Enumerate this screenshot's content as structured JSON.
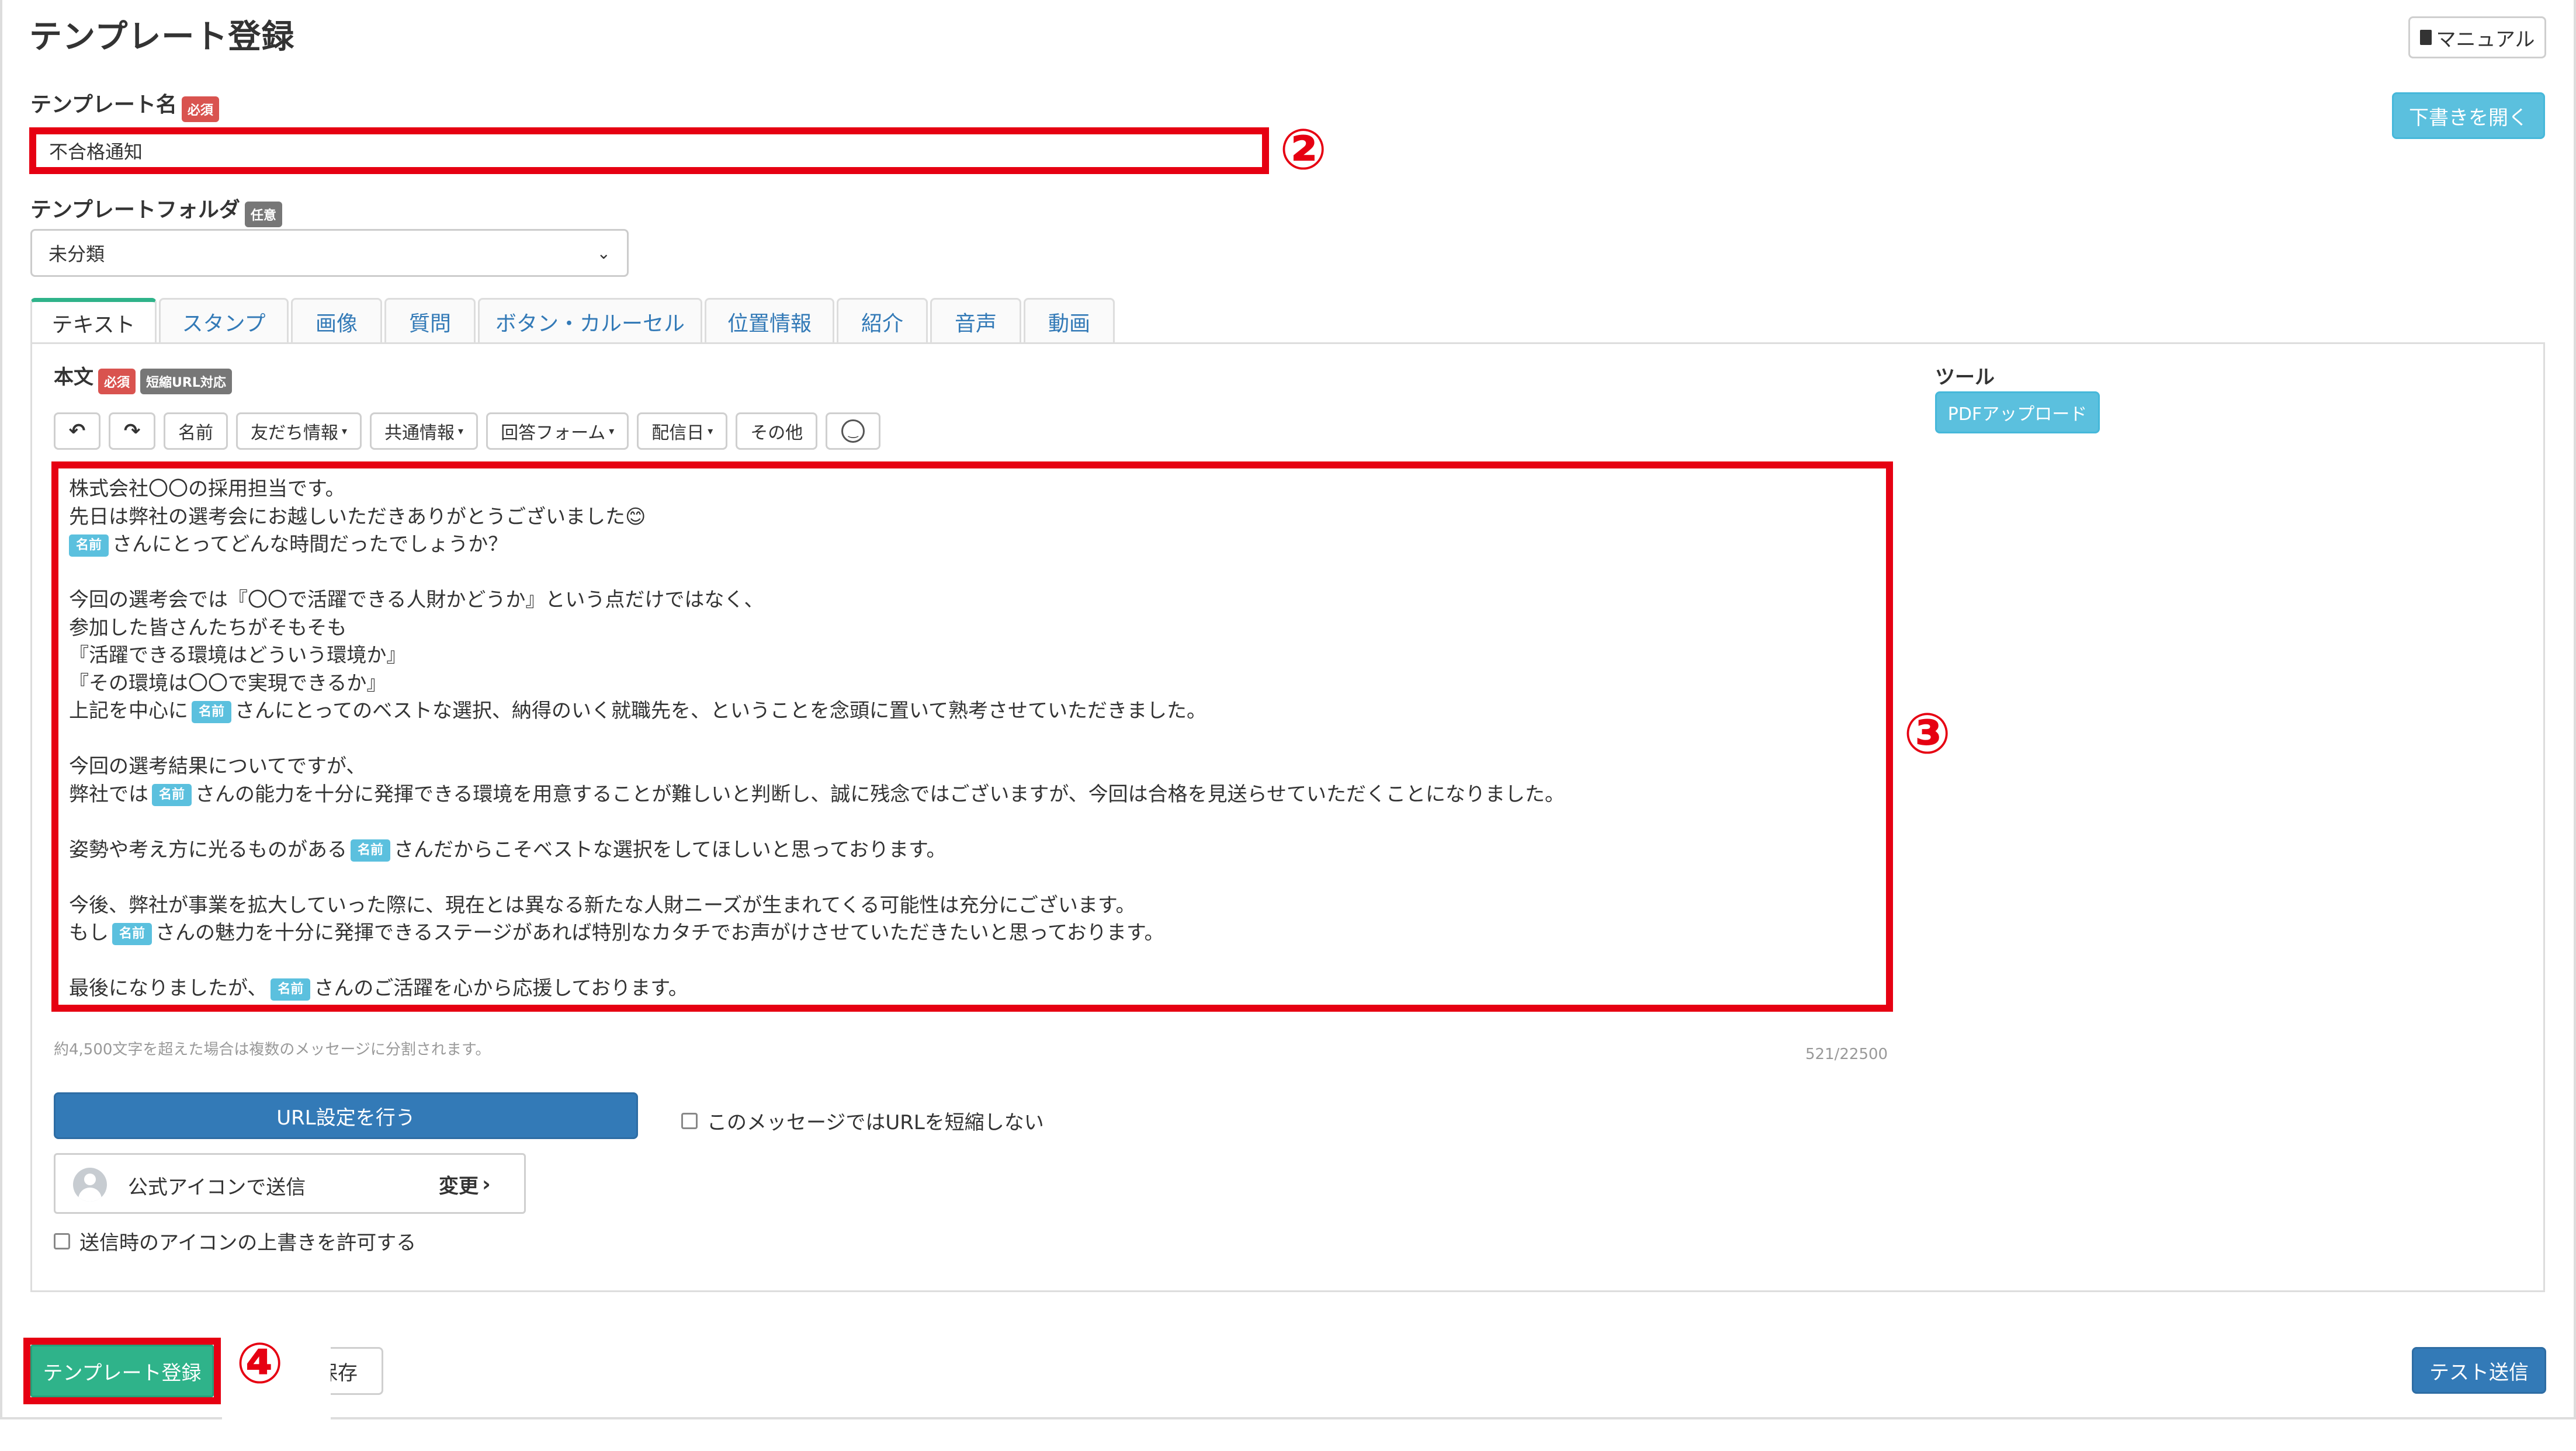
{
  "header": {
    "title": "テンプレート登録",
    "manual_label": "マニュアル",
    "open_draft_label": "下書きを開く"
  },
  "template_name": {
    "label": "テンプレート名",
    "required_badge": "必須",
    "value": "不合格通知",
    "annotation": "②"
  },
  "template_folder": {
    "label": "テンプレートフォルダ",
    "optional_badge": "任意",
    "selected": "未分類"
  },
  "tabs": [
    {
      "label": "テキスト"
    },
    {
      "label": "スタンプ"
    },
    {
      "label": "画像"
    },
    {
      "label": "質問"
    },
    {
      "label": "ボタン・カルーセル"
    },
    {
      "label": "位置情報"
    },
    {
      "label": "紹介"
    },
    {
      "label": "音声"
    },
    {
      "label": "動画"
    }
  ],
  "body": {
    "label": "本文",
    "required_badge": "必須",
    "short_url_badge": "短縮URL対応",
    "toolbar": {
      "undo": "undo-icon",
      "redo": "redo-icon",
      "name": "名前",
      "friend_info": "友だち情報",
      "shared_info": "共通情報",
      "answer_form": "回答フォーム",
      "delivery_date": "配信日",
      "other": "その他",
      "emoji": "emoji-icon"
    },
    "name_tag": "名前",
    "lines": [
      "株式会社〇〇の採用担当です。",
      "先日は弊社の選考会にお越しいただきありがとうございました😊",
      "さんにとってどんな時間だったでしょうか？",
      "今回の選考会では『〇〇で活躍できる人財かどうか』という点だけではなく、",
      "参加した皆さんたちがそもそも",
      "『活躍できる環境はどういう環境か』",
      "『その環境は〇〇で実現できるか』",
      "上記を中心に",
      "さんにとってのベストな選択、納得のいく就職先を、ということを念頭に置いて熟考させていただきました。",
      "今回の選考結果についてですが、",
      "弊社では",
      "さんの能力を十分に発揮できる環境を用意することが難しいと判断し、誠に残念ではございますが、今回は合格を見送らせていただくことになりました。",
      "姿勢や考え方に光るものがある",
      "さんだからこそベストな選択をしてほしいと思っております。",
      "今後、弊社が事業を拡大していった際に、現在とは異なる新たな人財ニーズが生まれてくる可能性は充分にございます。",
      "もし",
      "さんの魅力を十分に発揮できるステージがあれば特別なカタチでお声がけさせていただきたいと思っております。",
      "最後になりましたが、",
      "さんのご活躍を心から応援しております。"
    ],
    "annotation": "③",
    "split_note": "約4,500文字を超えた場合は複数のメッセージに分割されます。",
    "char_count": "521/22500"
  },
  "tools": {
    "label": "ツール",
    "pdf_upload": "PDFアップロード"
  },
  "url_settings": {
    "button": "URL設定を行う",
    "no_shorten_label": "このメッセージではURLを短縮しない"
  },
  "icon": {
    "label": "公式アイコンで送信",
    "change": "変更"
  },
  "allow_icon_override": "送信時のアイコンの上書きを許可する",
  "footer": {
    "register": "テンプレート登録",
    "save": "保存",
    "test_send": "テスト送信",
    "annotation": "④"
  },
  "colors": {
    "annotation_red": "#e60012",
    "primary": "#337ab7",
    "info": "#5bc0de",
    "success": "#2fb38a",
    "danger": "#d9534f"
  }
}
